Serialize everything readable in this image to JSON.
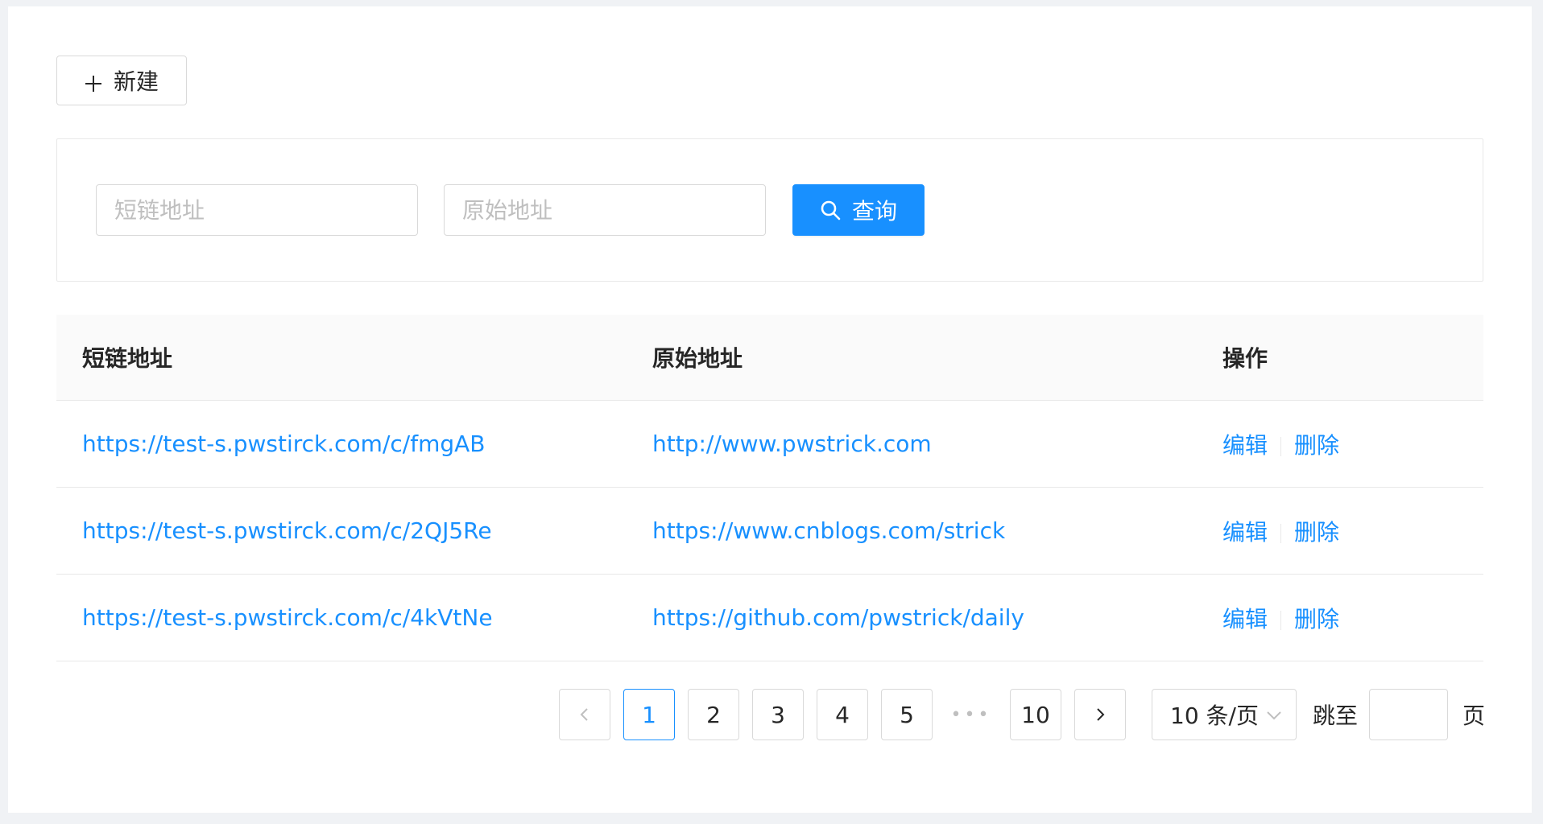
{
  "toolbar": {
    "new_label": "新建"
  },
  "search": {
    "short_placeholder": "短链地址",
    "orig_placeholder": "原始地址",
    "query_label": "查询"
  },
  "table": {
    "headers": [
      "短链地址",
      "原始地址",
      "操作"
    ],
    "rows": [
      {
        "short": "https://test-s.pwstirck.com/c/fmgAB",
        "orig": "http://www.pwstrick.com",
        "edit": "编辑",
        "delete": "删除"
      },
      {
        "short": "https://test-s.pwstirck.com/c/2QJ5Re",
        "orig": "https://www.cnblogs.com/strick",
        "edit": "编辑",
        "delete": "删除"
      },
      {
        "short": "https://test-s.pwstirck.com/c/4kVtNe",
        "orig": "https://github.com/pwstrick/daily",
        "edit": "编辑",
        "delete": "删除"
      }
    ]
  },
  "pagination": {
    "pages": [
      "1",
      "2",
      "3",
      "4",
      "5"
    ],
    "ellipsis": "•••",
    "last_page": "10",
    "current": "1",
    "page_size": "10 条/页",
    "jump_label": "跳至",
    "page_suffix": "页"
  },
  "colors": {
    "primary": "#1890ff",
    "border": "#d9d9d9",
    "header_bg": "#fafafa"
  },
  "icons": {
    "new": "plus-icon",
    "query": "search-icon",
    "prev": "chevron-left-icon",
    "next": "chevron-right-icon",
    "size": "chevron-down-icon"
  }
}
